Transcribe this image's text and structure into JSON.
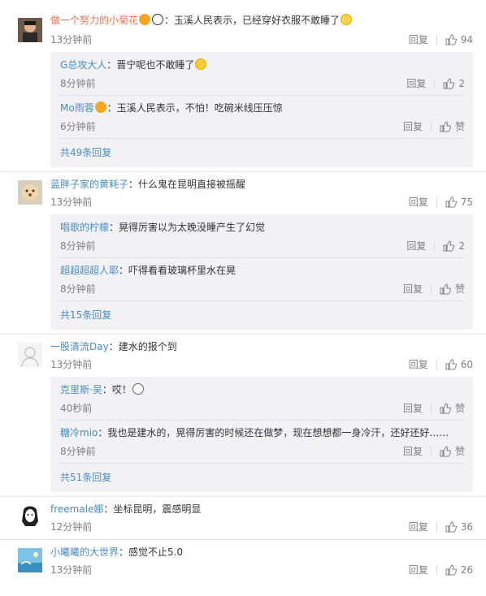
{
  "reply_label": "回复",
  "comments": [
    {
      "user": "做一个努力的小菊花",
      "user_color": "orange",
      "text": "：玉溪人民表示，已经穿好衣服不敢睡了",
      "time": "13分钟前",
      "likes": "94",
      "replies": [
        {
          "user": "G总攻大人",
          "text": "：晋宁呢也不敢睡了",
          "time": "8分钟前",
          "likes": "2"
        },
        {
          "user": "Mo雨蓉",
          "text": "：玉溪人民表示，不怕！吃碗米线压压惊",
          "time": "6分钟前",
          "likes": "赞"
        }
      ],
      "more": "共49条回复"
    },
    {
      "user": "蓝胖子家的黄耗子",
      "user_color": "blue",
      "text": "：什么鬼在昆明直接被摇醒",
      "time": "13分钟前",
      "likes": "75",
      "replies": [
        {
          "user": "唱歌的柠檬",
          "text": "：晃得厉害以为太晚没睡产生了幻觉",
          "time": "8分钟前",
          "likes": "2"
        },
        {
          "user": "超超超超人耶",
          "text": "：吓得看看玻璃杯里水在晃",
          "time": "8分钟前",
          "likes": "赞"
        }
      ],
      "more": "共15条回复"
    },
    {
      "user": "一股清流Day",
      "user_color": "blue",
      "text": "：建水的报个到",
      "time": "13分钟前",
      "likes": "60",
      "replies": [
        {
          "user": "克里斯·吴",
          "text": "：哎！",
          "time": "40秒前",
          "likes": "赞"
        },
        {
          "user": "糖冷mio",
          "text": "：我也是建水的，晃得厉害的时候还在做梦，现在想想都一身冷汗，还好还好……",
          "time": "8分钟前",
          "likes": "赞"
        }
      ],
      "more": "共51条回复"
    },
    {
      "user": "freemale娜",
      "user_color": "blue",
      "text": "：坐标昆明，震感明显",
      "time": "12分钟前",
      "likes": "36",
      "replies": [],
      "more": ""
    },
    {
      "user": "小曦曦的大世界",
      "user_color": "blue",
      "text": "：感觉不止5.0",
      "time": "13分钟前",
      "likes": "26",
      "replies": [],
      "more": ""
    }
  ]
}
